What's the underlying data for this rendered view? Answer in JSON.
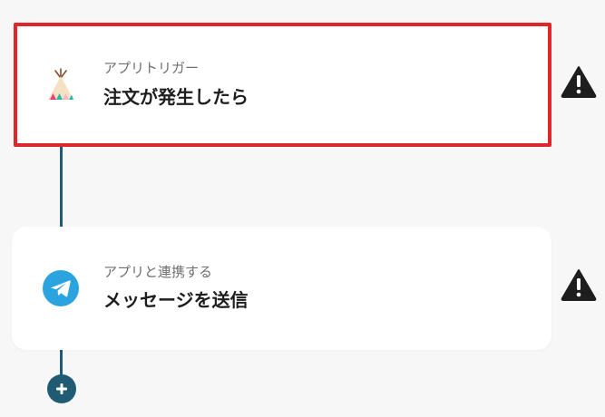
{
  "flow": {
    "trigger": {
      "subtitle": "アプリトリガー",
      "title": "注文が発生したら",
      "app_icon": "teepee-icon",
      "status_icon": "warning-icon",
      "selected": true,
      "highlight_color": "#e0262b"
    },
    "action": {
      "subtitle": "アプリと連携する",
      "title": "メッセージを送信",
      "app_icon": "telegram-icon",
      "status_icon": "warning-icon"
    },
    "add_step": {
      "icon": "plus-icon"
    },
    "colors": {
      "connector": "#1f5b73",
      "telegram": "#2aa3de",
      "warning": "#1e1e1e"
    }
  }
}
